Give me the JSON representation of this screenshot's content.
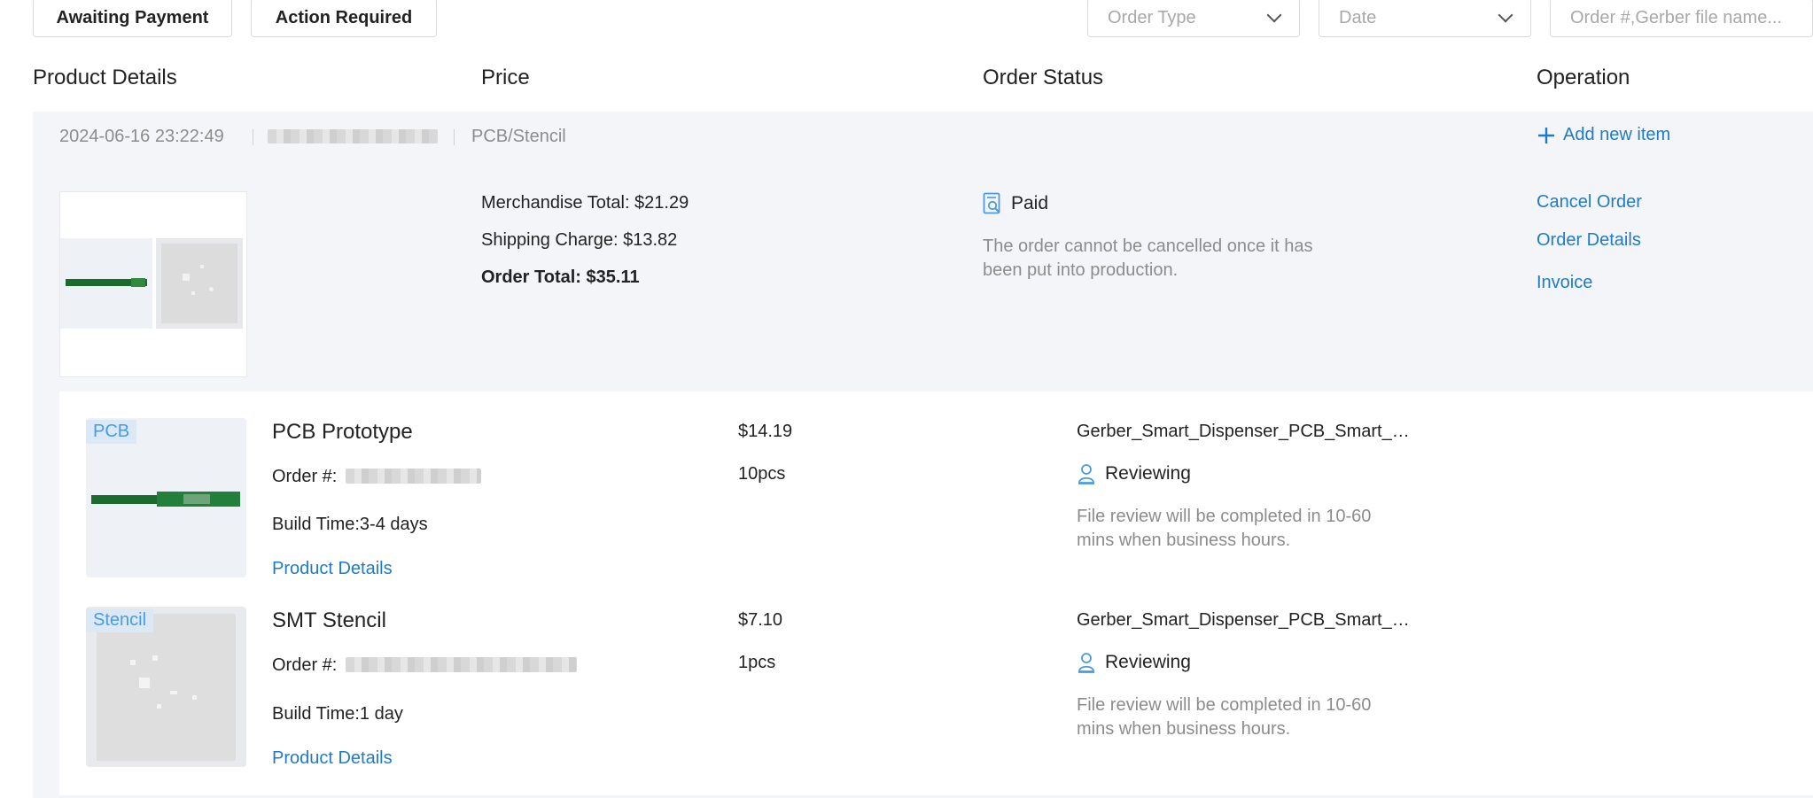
{
  "filters": {
    "tabs": [
      "Awaiting Payment",
      "Action Required"
    ],
    "order_type_placeholder": "Order Type",
    "date_placeholder": "Date",
    "search_placeholder": "Order #,Gerber file name..."
  },
  "columns": [
    "Product Details",
    "Price",
    "Order Status",
    "Operation"
  ],
  "order": {
    "timestamp": "2024-06-16 23:22:49",
    "category": "PCB/Stencil",
    "add_item_label": "Add new item",
    "merchandise_total": "Merchandise Total: $21.29",
    "shipping_charge": "Shipping Charge: $13.82",
    "order_total": "Order Total: $35.11",
    "status": "Paid",
    "status_note": "The order cannot be cancelled once it has been put into production.",
    "operations": [
      "Cancel Order",
      "Order Details",
      "Invoice"
    ]
  },
  "items": [
    {
      "badge": "PCB",
      "title": "PCB Prototype",
      "order_label": "Order #:",
      "build_time": "Build Time:3-4 days",
      "details_link": "Product Details",
      "price": "$14.19",
      "quantity": "10pcs",
      "file_name": "Gerber_Smart_Dispenser_PCB_Smart_Dispenser",
      "status": "Reviewing",
      "status_note": "File review will be completed in 10-60 mins when business hours."
    },
    {
      "badge": "Stencil",
      "title": "SMT Stencil",
      "order_label": "Order #:",
      "build_time": "Build Time:1 day",
      "details_link": "Product Details",
      "price": "$7.10",
      "quantity": "1pcs",
      "file_name": "Gerber_Smart_Dispenser_PCB_Smart_Dispenser",
      "status": "Reviewing",
      "status_note": "File review will be completed in 10-60 mins when business hours."
    }
  ],
  "colors": {
    "link": "#1f7bc8",
    "group_bg": "#f3f5f8",
    "muted_text": "#8c8c8c",
    "badge_bg": "#dbe9f7",
    "pcb_green": "#1c6b2e"
  },
  "icons": {
    "paid": "receipt-search-icon",
    "reviewing": "person-review-icon",
    "add": "plus-icon",
    "dropdown": "chevron-down-icon"
  }
}
